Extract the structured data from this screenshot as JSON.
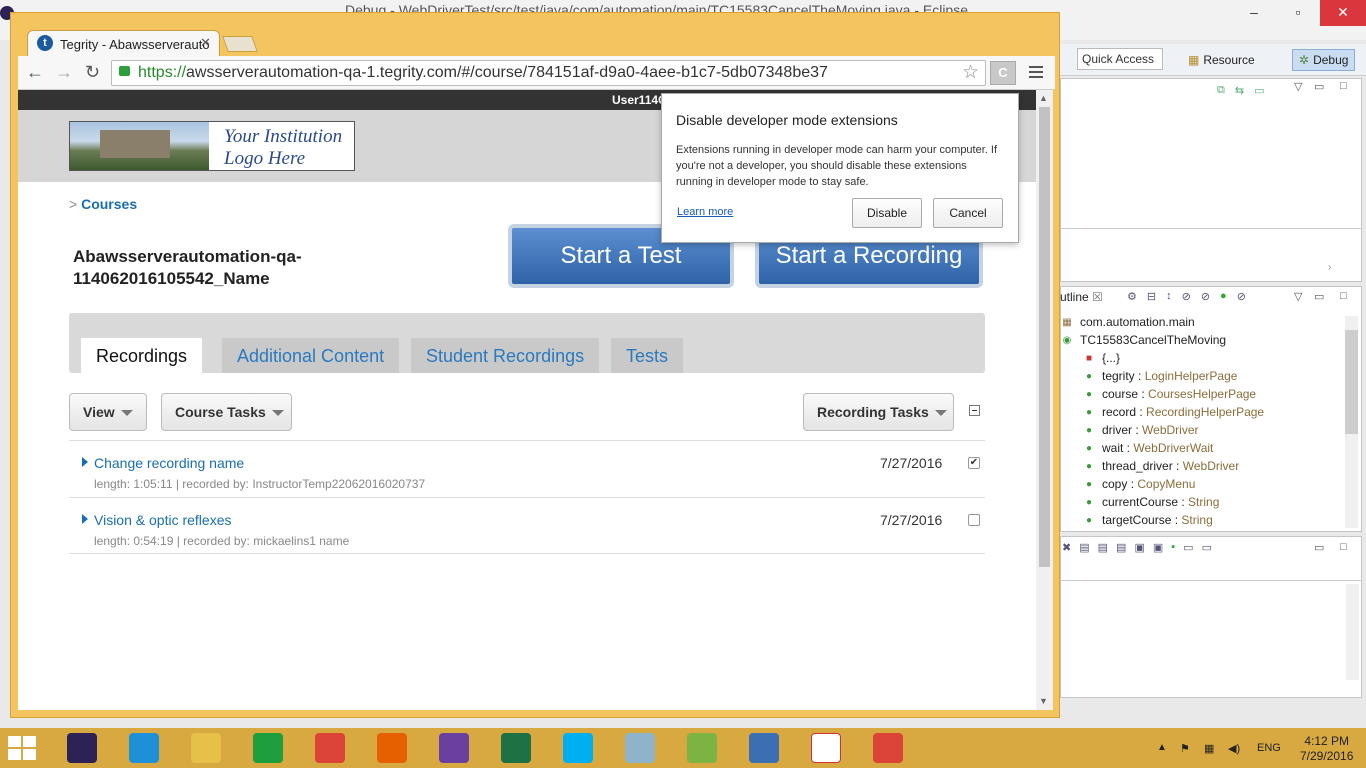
{
  "eclipse": {
    "title": "Debug - WebDriverTest/src/test/java/com/automation/main/TC15583CancelTheMoving.java - Eclipse",
    "window_controls": [
      "–",
      "▫",
      "✕"
    ],
    "quick_access": "Quick Access",
    "perspectives": [
      "Resource",
      "Debug"
    ],
    "outline_tab": "utline",
    "outline": [
      {
        "icon": "package-icon",
        "name": "com.automation.main",
        "type": ""
      },
      {
        "icon": "class-icon",
        "name": "TC15583CancelTheMoving",
        "type": ""
      },
      {
        "icon": "initializer-icon",
        "name": "{...}",
        "type": ""
      },
      {
        "icon": "field-icon",
        "name": "tegrity",
        "sep": " : ",
        "type": "LoginHelperPage"
      },
      {
        "icon": "field-icon",
        "name": "course",
        "sep": " : ",
        "type": "CoursesHelperPage"
      },
      {
        "icon": "field-icon",
        "name": "record",
        "sep": " : ",
        "type": "RecordingHelperPage"
      },
      {
        "icon": "field-icon",
        "name": "driver",
        "sep": " : ",
        "type": "WebDriver"
      },
      {
        "icon": "field-icon",
        "name": "wait",
        "sep": " : ",
        "type": "WebDriverWait"
      },
      {
        "icon": "field-icon",
        "name": "thread_driver",
        "sep": " : ",
        "type": "WebDriver"
      },
      {
        "icon": "field-icon",
        "name": "copy",
        "sep": " : ",
        "type": "CopyMenu"
      },
      {
        "icon": "field-icon",
        "name": "currentCourse",
        "sep": " : ",
        "type": "String"
      },
      {
        "icon": "field-icon",
        "name": "targetCourse",
        "sep": " : ",
        "type": "String"
      }
    ]
  },
  "browser": {
    "tab_title": "Tegrity - Abawsserverauto",
    "url_scheme": "https://",
    "url_rest": "awsserverautomation-qa-1.tegrity.com/#/course/784151af-d9a0-4aee-b1c7-5db07348be37",
    "extension_label": "C"
  },
  "page": {
    "user": "User114C",
    "logo_line1": "Your Institution",
    "logo_line2": "Logo Here",
    "breadcrumb_sep": ">",
    "breadcrumb": "Courses",
    "course_title_line1": "Abawsserverautomation-qa-",
    "course_title_line2": "114062016105542_Name",
    "start_test": "Start a Test",
    "start_recording": "Start a Recording",
    "tabs": [
      "Recordings",
      "Additional Content",
      "Student Recordings",
      "Tests"
    ],
    "view_btn": "View",
    "course_tasks_btn": "Course Tasks",
    "recording_tasks_btn": "Recording Tasks",
    "recordings": [
      {
        "name": "Change recording name",
        "meta": "length: 1:05:11 | recorded by: InstructorTemp22062016020737",
        "date": "7/27/2016",
        "checked": true
      },
      {
        "name": "Vision & optic reflexes",
        "meta": "length: 0:54:19 | recorded by: mickaelins1 name",
        "date": "7/27/2016",
        "checked": false
      }
    ]
  },
  "popup": {
    "title": "Disable developer mode extensions",
    "body": "Extensions running in developer mode can harm your computer. If you're not a developer, you should disable these extensions running in developer mode to stay safe.",
    "learn_more": "Learn more",
    "disable": "Disable",
    "cancel": "Cancel"
  },
  "taskbar": {
    "apps": [
      {
        "name": "eclipse-icon",
        "color": "#2c2255"
      },
      {
        "name": "internet-explorer-icon",
        "color": "#1e90d8"
      },
      {
        "name": "file-explorer-icon",
        "color": "#e6c14a"
      },
      {
        "name": "store-icon",
        "color": "#1f9e3e"
      },
      {
        "name": "chrome-icon",
        "color": "#db4437"
      },
      {
        "name": "firefox-icon",
        "color": "#e66000"
      },
      {
        "name": "app-icon",
        "color": "#6b3fa0"
      },
      {
        "name": "excel-icon",
        "color": "#1d7145"
      },
      {
        "name": "skype-icon",
        "color": "#00aff0"
      },
      {
        "name": "notes-icon",
        "color": "#8fb4c9"
      },
      {
        "name": "notepad-plus-icon",
        "color": "#7cb342"
      },
      {
        "name": "remote-desktop-icon",
        "color": "#3c6eb4"
      },
      {
        "name": "vc-icon",
        "color": "#ffffff"
      },
      {
        "name": "chrome-icon-2",
        "color": "#db4437"
      }
    ],
    "lang": "ENG",
    "time": "4:12 PM",
    "date": "7/29/2016"
  }
}
